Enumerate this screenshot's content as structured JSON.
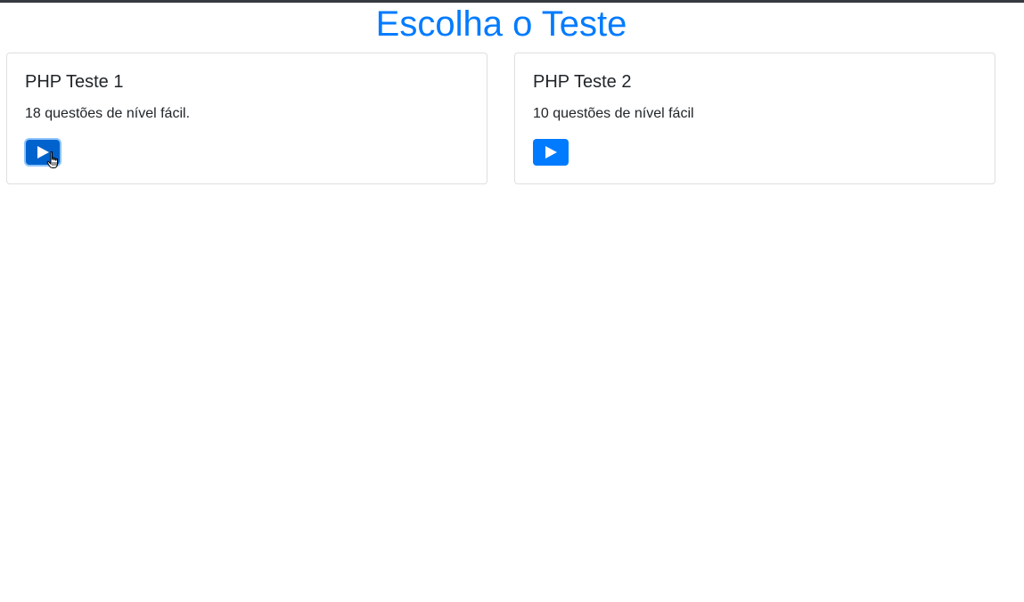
{
  "page": {
    "title": "Escolha o Teste"
  },
  "colors": {
    "accent": "#007bff",
    "accent_active": "#0062cc",
    "top_border": "#343a40",
    "text": "#212529"
  },
  "tests": [
    {
      "title": "PHP Teste 1",
      "description": "18 questões de nível fácil.",
      "start_icon": "play-icon"
    },
    {
      "title": "PHP Teste 2",
      "description": "10 questões de nível fácil",
      "start_icon": "play-icon"
    }
  ],
  "cursor": {
    "icon": "hand-pointer-icon"
  }
}
